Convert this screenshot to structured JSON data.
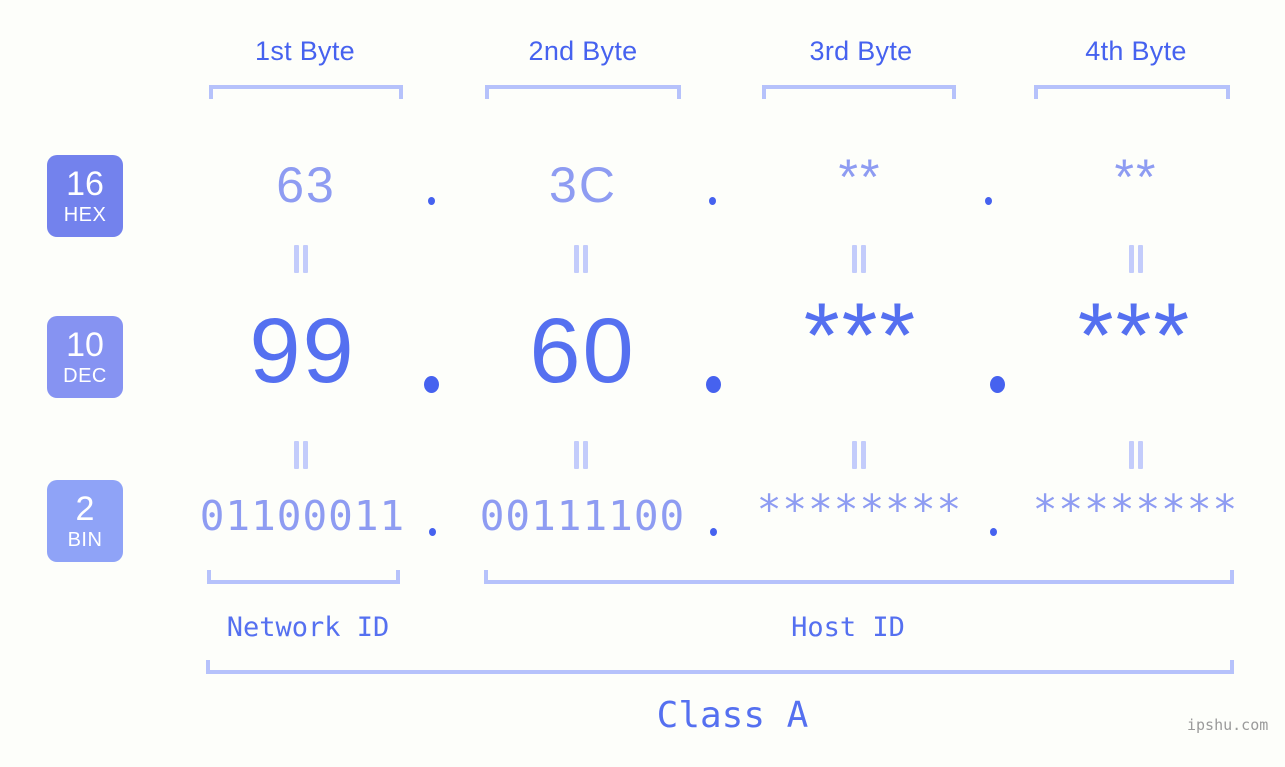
{
  "meta": {
    "background_color": "#fdfefa",
    "accent_strong": "#4662ef",
    "accent_mid": "#5570f0",
    "accent_soft": "#8e9cf2",
    "accent_bracket": "#b6c2fb",
    "watermark": "ipshu.com"
  },
  "byte_headers": [
    {
      "label": "1st Byte"
    },
    {
      "label": "2nd Byte"
    },
    {
      "label": "3rd Byte"
    },
    {
      "label": "4th Byte"
    }
  ],
  "rows": [
    {
      "badge": {
        "number": "16",
        "name": "HEX",
        "color": "#7382ed"
      },
      "values": [
        "63",
        "3C",
        "**",
        "**"
      ],
      "separator": "."
    },
    {
      "badge": {
        "number": "10",
        "name": "DEC",
        "color": "#8693f2"
      },
      "values": [
        "99",
        "60",
        "***",
        "***"
      ],
      "separator": "."
    },
    {
      "badge": {
        "number": "2",
        "name": "BIN",
        "color": "#8fa3f7"
      },
      "values": [
        "01100011",
        "00111100",
        "********",
        "********"
      ],
      "separator": "."
    }
  ],
  "equals_symbol": "=",
  "segments": {
    "network_id": "Network ID",
    "host_id": "Host ID",
    "class": "Class A"
  }
}
